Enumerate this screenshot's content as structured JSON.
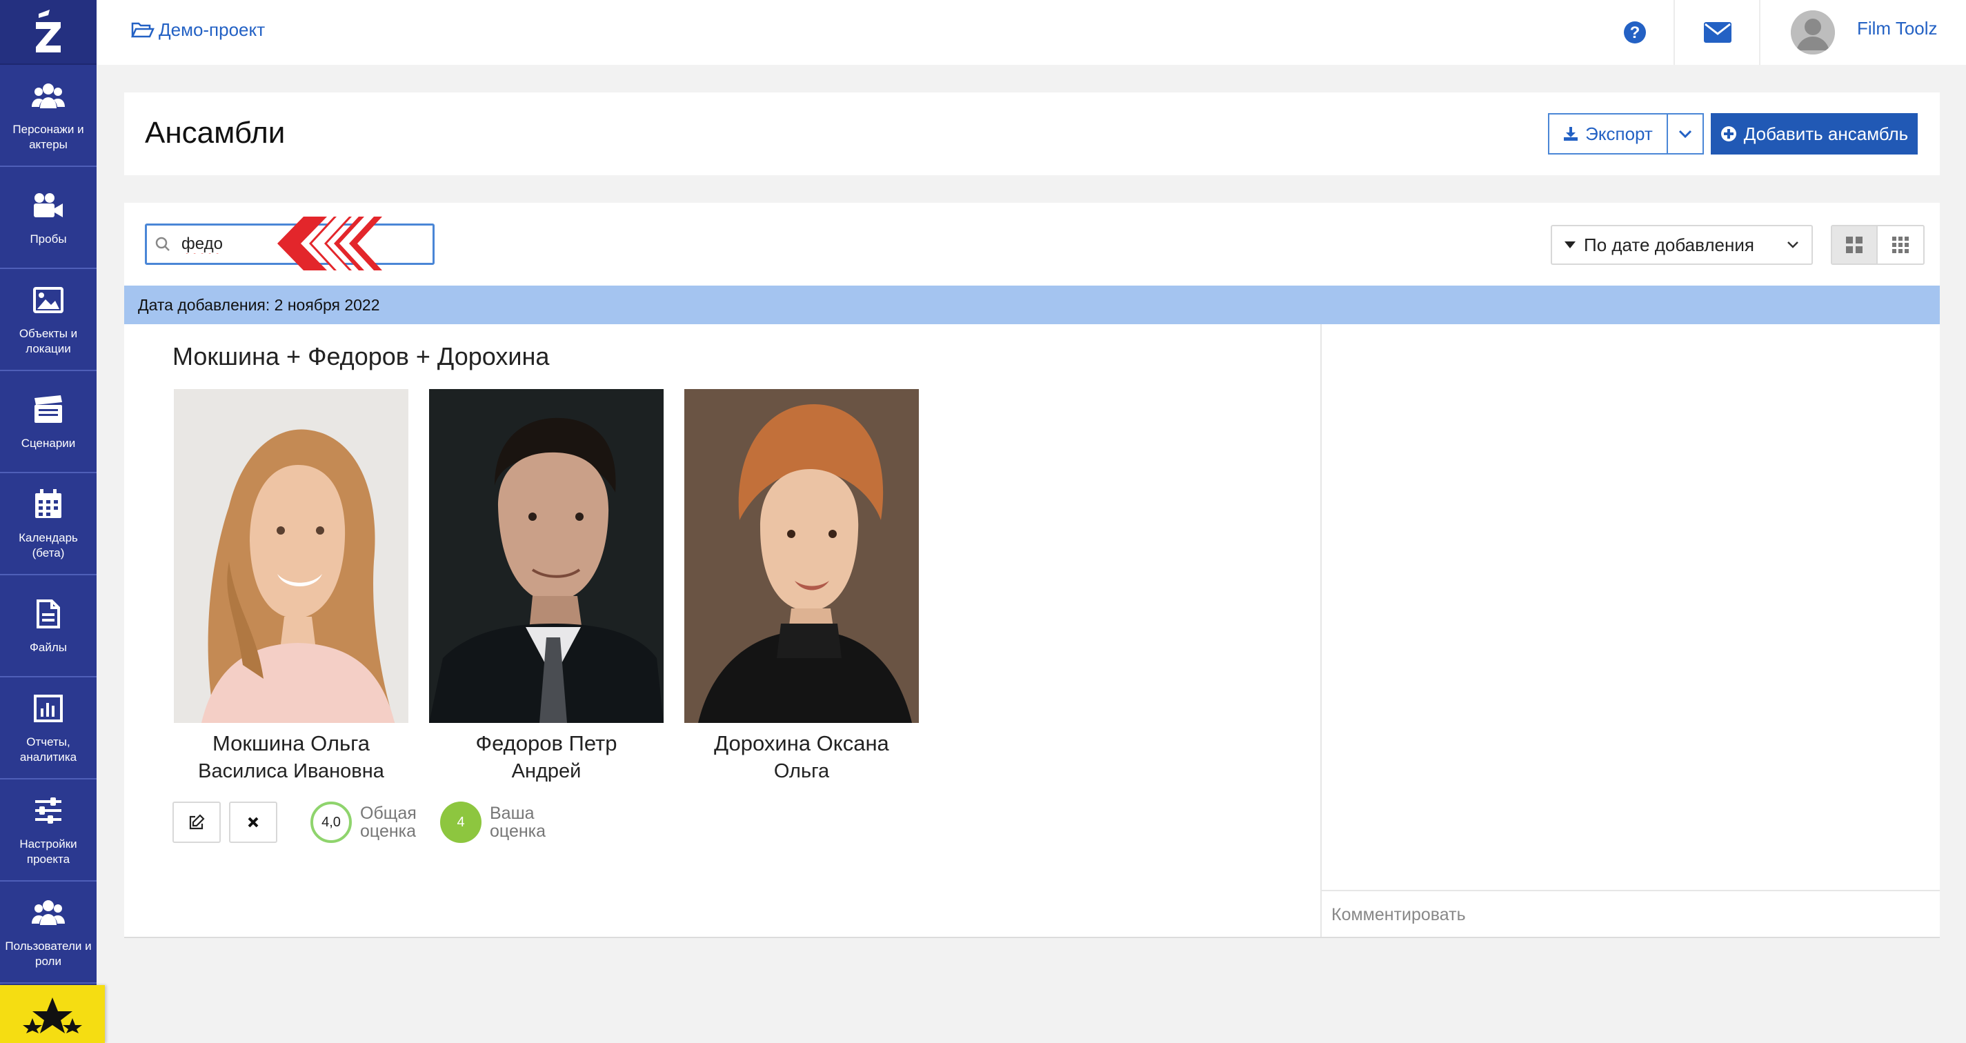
{
  "sidebar": {
    "items": [
      {
        "label": "Персонажи и\nактеры",
        "icon": "users-icon"
      },
      {
        "label": "Пробы",
        "icon": "video-camera-icon"
      },
      {
        "label": "Объекты и\nлокации",
        "icon": "image-icon"
      },
      {
        "label": "Сценарии",
        "icon": "clapperboard-icon"
      },
      {
        "label": "Календарь\n(бета)",
        "icon": "calendar-icon"
      },
      {
        "label": "Файлы",
        "icon": "file-icon"
      },
      {
        "label": "Отчеты,\nаналитика",
        "icon": "bar-chart-icon"
      },
      {
        "label": "Настройки\nпроекта",
        "icon": "sliders-icon"
      },
      {
        "label": "Пользователи и\nроли",
        "icon": "users-icon"
      }
    ]
  },
  "topbar": {
    "breadcrumb": "Демо-проект",
    "user_name": "Film Toolz"
  },
  "header": {
    "title": "Ансамбли",
    "export_label": "Экспорт",
    "add_label": "Добавить ансамбль"
  },
  "toolbar": {
    "search_value": "федо",
    "sort_label": "По дате добавления"
  },
  "group": {
    "date_label": "Дата добавления: 2 ноября 2022"
  },
  "ensemble": {
    "title": "Мокшина + Федоров + Дорохина",
    "actors": [
      {
        "name": "Мокшина Ольга",
        "role": "Василиса Ивановна"
      },
      {
        "name": "Федоров Петр",
        "role": "Андрей"
      },
      {
        "name": "Дорохина Оксана",
        "role": "Ольга"
      }
    ],
    "overall_rating": "4,0",
    "overall_label": "Общая\nоценка",
    "your_rating": "4",
    "your_label": "Ваша\nоценка"
  },
  "comment": {
    "placeholder": "Комментировать"
  },
  "colors": {
    "sidebar": "#2b3990",
    "accent": "#2159b5",
    "date_bar": "#a4c4f0",
    "rating_green": "#8dc63f",
    "premium_yellow": "#f5dd12",
    "arrow_red": "#e3262b"
  }
}
